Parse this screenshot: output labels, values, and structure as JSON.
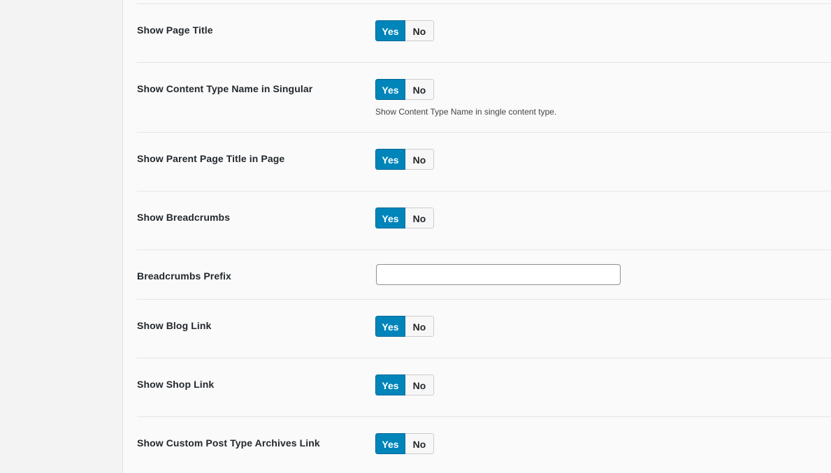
{
  "settings": [
    {
      "label": "Show Page Title",
      "yes": "Yes",
      "no": "No",
      "selected": "Yes"
    },
    {
      "label": "Show Content Type Name in Singular",
      "yes": "Yes",
      "no": "No",
      "selected": "Yes",
      "help": "Show Content Type Name in single content type."
    },
    {
      "label": "Show Parent Page Title in Page",
      "yes": "Yes",
      "no": "No",
      "selected": "Yes"
    },
    {
      "label": "Show Breadcrumbs",
      "yes": "Yes",
      "no": "No",
      "selected": "Yes"
    },
    {
      "label": "Breadcrumbs Prefix",
      "value": "",
      "placeholder": ""
    },
    {
      "label": "Show Blog Link",
      "yes": "Yes",
      "no": "No",
      "selected": "Yes"
    },
    {
      "label": "Show Shop Link",
      "yes": "Yes",
      "no": "No",
      "selected": "Yes"
    },
    {
      "label": "Show Custom Post Type Archives Link",
      "yes": "Yes",
      "no": "No",
      "selected": "Yes"
    }
  ],
  "colors": {
    "accent": "#0085ba",
    "accent_border": "#006799",
    "background": "#fafafa",
    "sidebar": "#f3f3f3"
  }
}
